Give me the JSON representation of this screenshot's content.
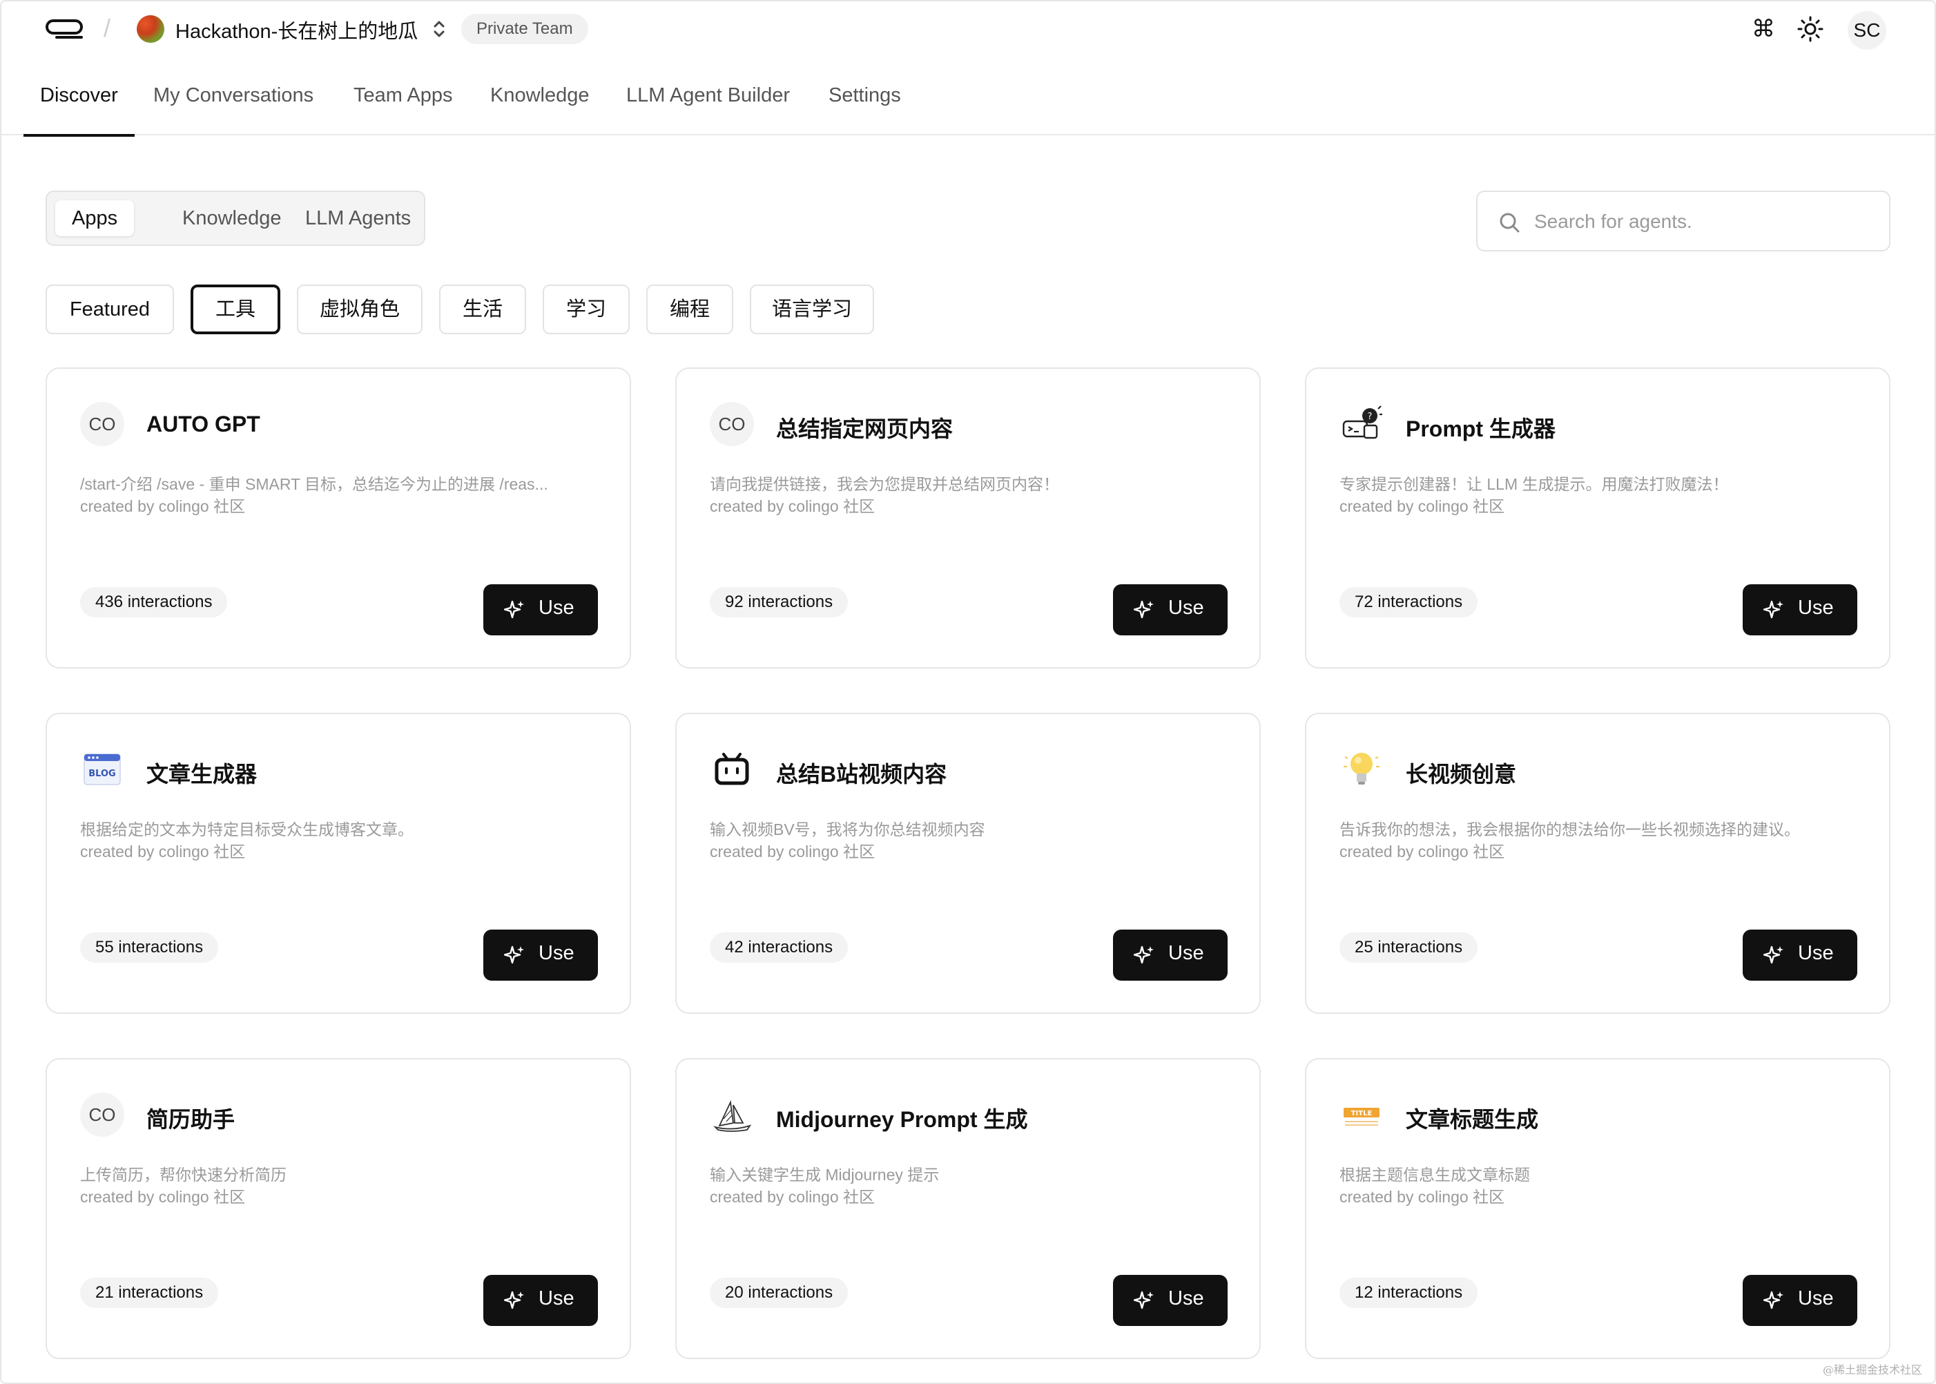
{
  "header": {
    "team_name": "Hackathon-长在树上的地瓜",
    "team_badge": "Private Team",
    "user_initials": "SC",
    "icons": [
      "menu-logo-icon",
      "team-switch-icon",
      "command-icon",
      "sun-icon"
    ]
  },
  "nav": {
    "tabs": [
      "Discover",
      "My Conversations",
      "Team Apps",
      "Knowledge",
      "LLM Agent Builder",
      "Settings"
    ],
    "active": "Discover"
  },
  "segment": {
    "items": [
      "Apps",
      "Knowledge",
      "LLM Agents"
    ],
    "active": "Apps"
  },
  "search": {
    "placeholder": "Search for agents.",
    "value": ""
  },
  "categories": {
    "items": [
      "Featured",
      "工具",
      "虚拟角色",
      "生活",
      "学习",
      "编程",
      "语言学习"
    ],
    "active": "工具"
  },
  "cards": [
    {
      "title": "AUTO GPT",
      "desc": "/start-介绍 /save - 重申 SMART 目标，总结迄今为止的进展 /reas...",
      "by": "created by colingo 社区",
      "count": "436 interactions",
      "icon": "co-avatar-icon",
      "icon_text": "CO",
      "use": "Use"
    },
    {
      "title": "总结指定网页内容",
      "desc": "请向我提供链接，我会为您提取并总结网页内容！",
      "by": "created by colingo 社区",
      "count": "92 interactions",
      "icon": "co-avatar-icon",
      "icon_text": "CO",
      "use": "Use"
    },
    {
      "title": "Prompt 生成器",
      "desc": "专家提示创建器！让 LLM 生成提示。用魔法打败魔法！",
      "by": "created by colingo 社区",
      "count": "72 interactions",
      "icon": "prompt-bot-icon",
      "icon_text": "",
      "use": "Use"
    },
    {
      "title": "文章生成器",
      "desc": "根据给定的文本为特定目标受众生成博客文章。",
      "by": "created by colingo 社区",
      "count": "55 interactions",
      "icon": "blog-icon",
      "icon_text": "BLOG",
      "use": "Use"
    },
    {
      "title": "总结B站视频内容",
      "desc": "输入视频BV号，我将为你总结视频内容",
      "by": "created by colingo 社区",
      "count": "42 interactions",
      "icon": "bilibili-tv-icon",
      "icon_text": "",
      "use": "Use"
    },
    {
      "title": "长视频创意",
      "desc": "告诉我你的想法，我会根据你的想法给你一些长视频选择的建议。",
      "by": "created by colingo 社区",
      "count": "25 interactions",
      "icon": "lightbulb-icon",
      "icon_text": "",
      "use": "Use"
    },
    {
      "title": "简历助手",
      "desc": "上传简历，帮你快速分析简历",
      "by": "created by colingo 社区",
      "count": "21 interactions",
      "icon": "co-avatar-icon",
      "icon_text": "CO",
      "use": "Use"
    },
    {
      "title": "Midjourney Prompt 生成",
      "desc": "输入关键字生成 Midjourney 提示",
      "by": "created by colingo 社区",
      "count": "20 interactions",
      "icon": "sailboat-icon",
      "icon_text": "",
      "use": "Use"
    },
    {
      "title": "文章标题生成",
      "desc": "根据主题信息生成文章标题",
      "by": "created by colingo 社区",
      "count": "12 interactions",
      "icon": "title-tag-icon",
      "icon_text": "TITLE",
      "use": "Use"
    }
  ],
  "watermark": "@稀土掘金技术社区"
}
